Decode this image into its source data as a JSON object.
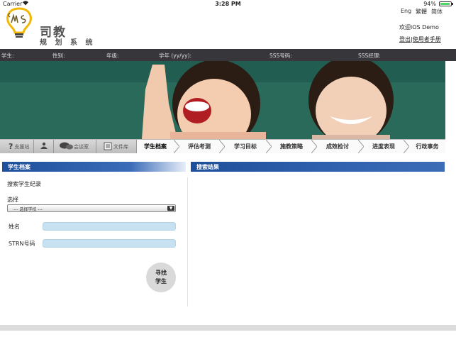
{
  "status_bar": {
    "carrier": "Carrier",
    "time": "3:28 PM",
    "battery": "94%",
    "battery_level": 0.94
  },
  "header": {
    "logo_letters": "SMS",
    "title": "司教",
    "subtitle": "规 划 系 统",
    "languages": [
      "Eng",
      "繁體",
      "简体"
    ],
    "welcome": "欢迎iOS Demo",
    "login_label": "登出",
    "separator": "|",
    "manual_label": "使用者手册"
  },
  "info_bar": {
    "student": "学生:",
    "gender": "性别:",
    "grade": "年级:",
    "school_year": "学年 (yy/yy):",
    "sss_number": "SSS号码:",
    "sss_manager": "SSS经理:"
  },
  "nav": {
    "utilities": [
      {
        "icon": "help-icon",
        "label": "支援站"
      },
      {
        "icon": "people-icon",
        "label": ""
      },
      {
        "icon": "chat-icon",
        "label": "会谈室"
      },
      {
        "icon": "document-icon",
        "label": "文件库"
      }
    ],
    "tabs": [
      "学生档案",
      "评估考测",
      "学习目标",
      "施教策略",
      "成效检讨",
      "进度表现",
      "行政事务"
    ],
    "active_tab": "学生档案"
  },
  "left_panel": {
    "title": "学生档案",
    "search_heading": "搜索学生纪录",
    "select_label": "选择",
    "select_value": "--- 选择学校 ---",
    "name_label": "姓名",
    "name_value": "",
    "strn_label": "STRN号码",
    "strn_value": "",
    "search_button": "寻找\n学生"
  },
  "right_panel": {
    "title": "搜索结果"
  },
  "colors": {
    "panel_header": "#1d4f9a",
    "info_bar": "#37363a",
    "input_fill": "#c5e1f2",
    "accent": "#2a61b0"
  }
}
